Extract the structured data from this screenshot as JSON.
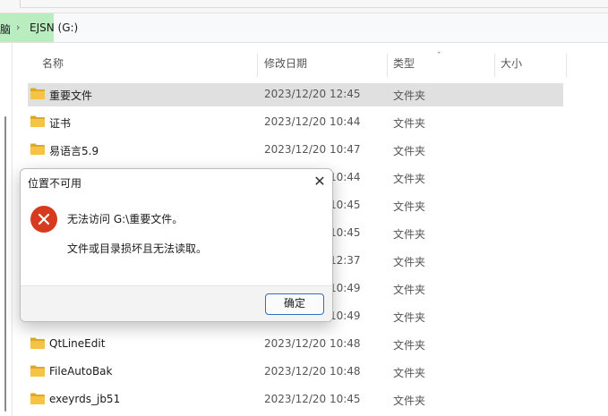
{
  "address": {
    "crumb_partial": "脑",
    "separator": "›",
    "drive": "EJSN (G:)"
  },
  "columns": {
    "name": "名称",
    "modified": "修改日期",
    "type": "类型",
    "size": "大小",
    "sort_indicator": "ˇ"
  },
  "rows": [
    {
      "name": "重要文件",
      "date": "2023/12/20 12:45",
      "type": "文件夹",
      "selected": true
    },
    {
      "name": "证书",
      "date": "2023/12/20 10:44",
      "type": "文件夹"
    },
    {
      "name": "易语言5.9",
      "date": "2023/12/20 10:47",
      "type": "文件夹"
    },
    {
      "name": "",
      "date": "2023/12/20 10:44",
      "type": "文件夹"
    },
    {
      "name": "",
      "date": "2023/12/20 10:45",
      "type": "文件夹"
    },
    {
      "name": "",
      "date": "2023/12/20 10:45",
      "type": "文件夹"
    },
    {
      "name": "",
      "date": "2023/12/20 12:37",
      "type": "文件夹"
    },
    {
      "name": "",
      "date": "2023/12/20 10:49",
      "type": "文件夹"
    },
    {
      "name": "",
      "date": "2023/12/20 10:49",
      "type": "文件夹"
    },
    {
      "name": "QtLineEdit",
      "date": "2023/12/20 10:48",
      "type": "文件夹"
    },
    {
      "name": "FileAutoBak",
      "date": "2023/12/20 10:48",
      "type": "文件夹"
    },
    {
      "name": "exeyrds_jb51",
      "date": "2023/12/20 10:45",
      "type": "文件夹"
    }
  ],
  "dialog": {
    "title": "位置不可用",
    "close": "✕",
    "message": "无法访问 G:\\重要文件。",
    "detail": "文件或目录损坏且无法读取。",
    "ok": "确定"
  },
  "colors": {
    "folder": "#f6c344",
    "folder_dark": "#e0a82a",
    "error": "#d73b1f",
    "selection": "#e0e0e0",
    "address_highlight": "#b9ecbf",
    "button_border": "#2f6fc1"
  }
}
